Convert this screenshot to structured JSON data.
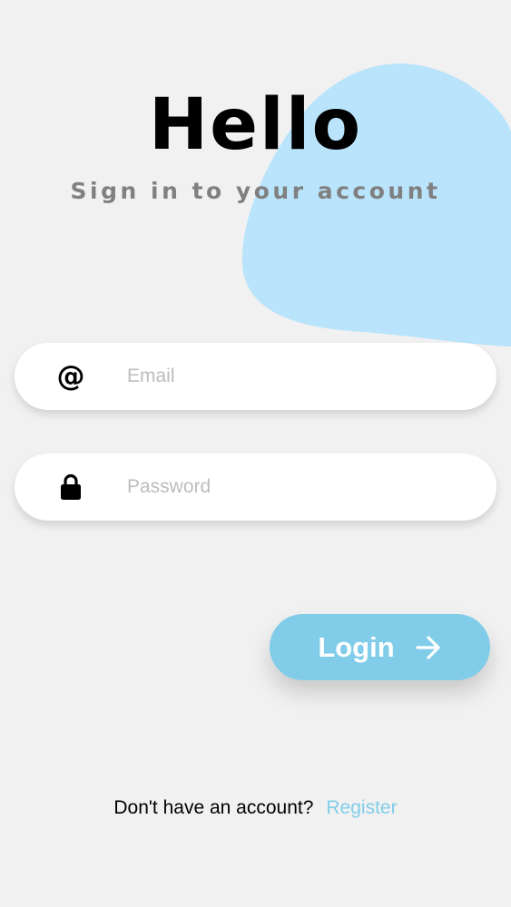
{
  "header": {
    "title": "Hello",
    "subtitle": "Sign in to your account"
  },
  "form": {
    "email": {
      "icon": "at-sign-icon",
      "placeholder": "Email",
      "value": ""
    },
    "password": {
      "icon": "lock-icon",
      "placeholder": "Password",
      "value": ""
    }
  },
  "login_button": {
    "label": "Login",
    "icon": "arrow-right-icon"
  },
  "footer": {
    "prompt": "Don't have an account?",
    "link_label": "Register"
  },
  "colors": {
    "background": "#f1f1f1",
    "blob": "#b9e4fb",
    "accent": "#81cde9",
    "title": "#000000",
    "subtitle": "#808080",
    "placeholder": "#bdbdbd"
  }
}
